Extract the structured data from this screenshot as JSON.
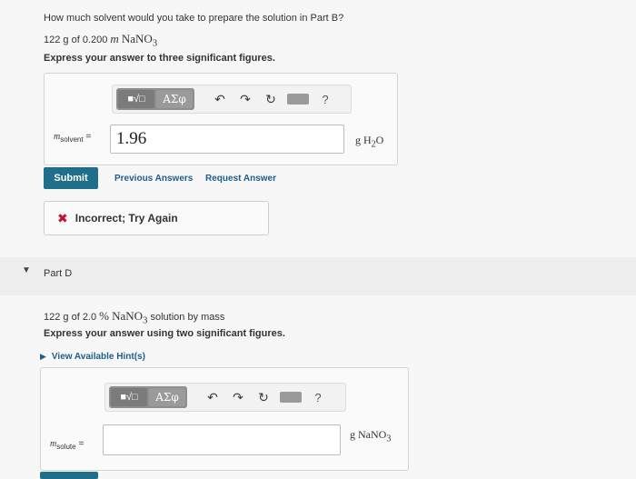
{
  "partC": {
    "question": "How much solvent would you take to prepare the solution in Part B?",
    "given_prefix": "122 g of 0.200",
    "given_unit": "m",
    "given_formula_html": "NaNO<sub>3</sub>",
    "instruction": "Express your answer to three significant figures.",
    "toolbar": {
      "templates_label": "■√□",
      "symbols_label": "ΑΣφ",
      "undo": "↶",
      "redo": "↷",
      "reset": "↻",
      "help": "?"
    },
    "field_label_main": "m",
    "field_label_sub": "solvent",
    "field_equals": "=",
    "answer_value": "1.96",
    "unit_html": "g H<sub>2</sub>O",
    "submit_label": "Submit",
    "previous_answers": "Previous Answers",
    "request_answer": "Request Answer",
    "feedback_icon": "✖",
    "feedback_text": "Incorrect; Try Again"
  },
  "partD": {
    "caret": "▼",
    "title": "Part D",
    "given_prefix": "122 g of 2.0",
    "given_percent": "%",
    "given_formula_html": "NaNO<sub>3</sub>",
    "given_suffix": "solution by mass",
    "instruction": "Express your answer using two significant figures.",
    "hint_arrow": "▶",
    "hint_label": "View Available Hint(s)",
    "toolbar": {
      "templates_label": "■√□",
      "symbols_label": "ΑΣφ",
      "undo": "↶",
      "redo": "↷",
      "reset": "↻",
      "help": "?"
    },
    "field_label_main": "m",
    "field_label_sub": "solute",
    "field_equals": "=",
    "answer_value": "",
    "unit_html": "g NaNO<sub>3</sub>"
  },
  "colors": {
    "submit": "#1f6e8a",
    "link": "#1f5d8c",
    "error": "#c8102e"
  }
}
